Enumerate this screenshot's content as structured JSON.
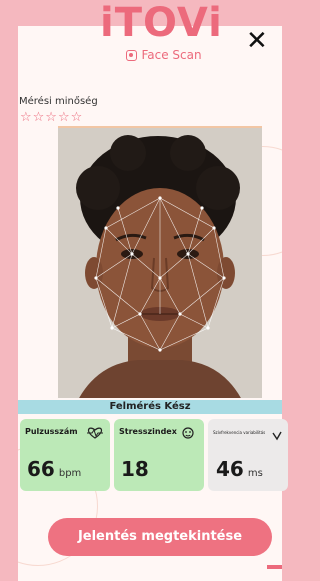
{
  "header": {
    "logo_text": "iTOVi",
    "subtitle": "Face Scan",
    "close_glyph": "✕"
  },
  "quality": {
    "label": "Mérési minőség",
    "stars": "☆☆☆☆☆",
    "rating": 0,
    "max": 5
  },
  "status": {
    "label": "Felmérés Kész"
  },
  "metrics": [
    {
      "title": "Pulzusszám",
      "value": "66",
      "unit": "bpm",
      "icon": "heart-rate-icon",
      "color": "#bce9b7"
    },
    {
      "title": "Stresszindex",
      "value": "18",
      "unit": "",
      "icon": "smiley-icon",
      "color": "#bce9b7"
    },
    {
      "title": "Szívfrekvencia variabilitás",
      "value": "46",
      "unit": "ms",
      "icon": "check-icon",
      "color": "#eceaea"
    }
  ],
  "actions": {
    "report_label": "Jelentés megtekintése"
  },
  "colors": {
    "accent": "#ec6a7c",
    "background": "#f5b8bf",
    "status_bar": "#a8dbe3"
  }
}
